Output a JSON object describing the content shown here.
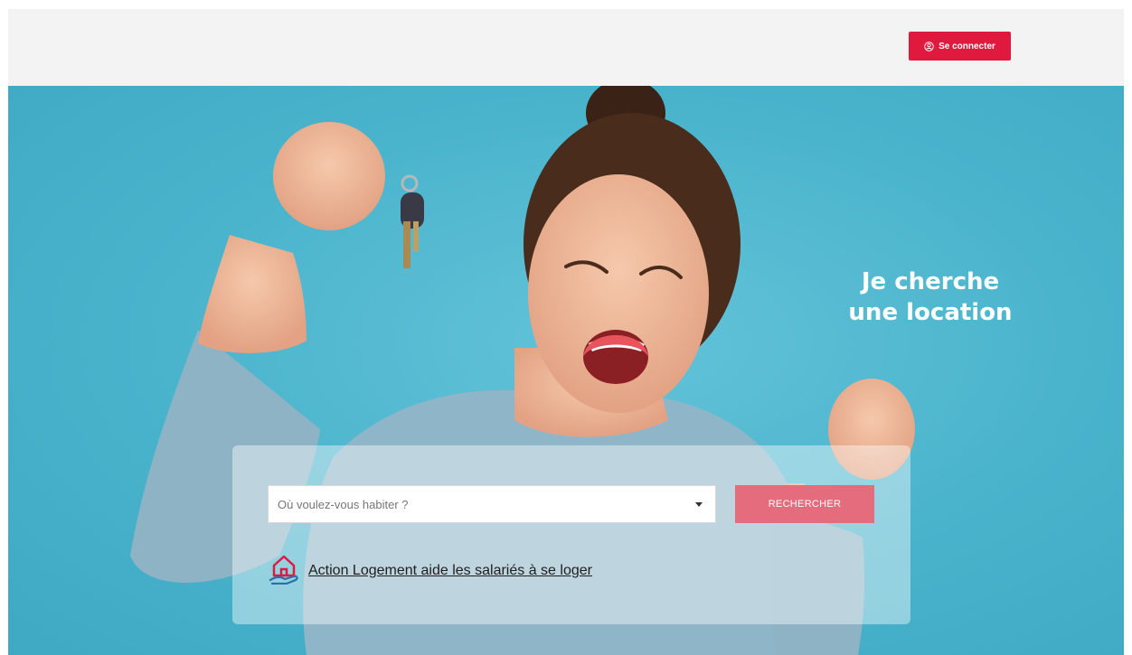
{
  "header": {
    "login_label": "Se connecter",
    "login_icon": "user-circle-icon",
    "background_color": "#f3f3f3",
    "button_color": "#e0193f"
  },
  "hero": {
    "title": "Je cherche\nune location",
    "background_color": "#4fb8cf"
  },
  "search": {
    "placeholder": "Où voulez-vous habiter ?",
    "button_label": "RECHERCHER",
    "button_color": "#e56c7c"
  },
  "promo_link": {
    "label": "Action Logement aide les salariés à se loger",
    "icon": "house-in-hand-icon"
  }
}
